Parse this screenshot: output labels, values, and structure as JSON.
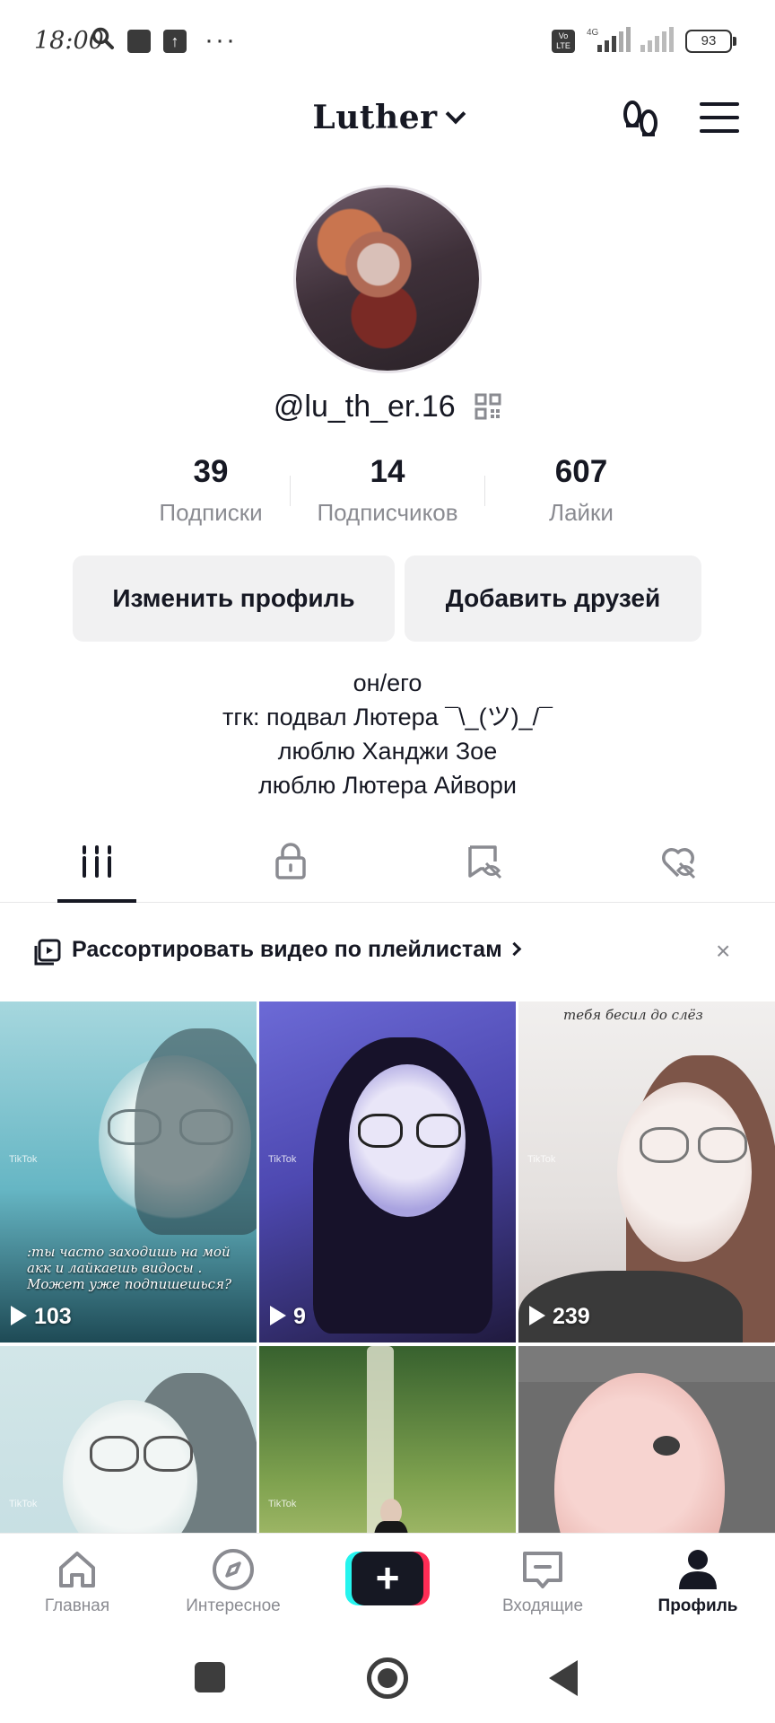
{
  "status_bar": {
    "time": "18:00",
    "volte": "Vo LTE",
    "network": "4G",
    "battery": "93"
  },
  "header": {
    "title": "Luther",
    "steps_icon": "footprints-icon",
    "menu_icon": "hamburger-menu-icon"
  },
  "profile": {
    "handle": "@lu_th_er.16",
    "stats": [
      {
        "value": "39",
        "label": "Подписки"
      },
      {
        "value": "14",
        "label": "Подписчиков"
      },
      {
        "value": "607",
        "label": "Лайки"
      }
    ],
    "edit_button": "Изменить профиль",
    "add_friends_button": "Добавить друзей",
    "bio": [
      "он/его",
      "тгк: подвал Лютера ¯\\_(ツ)_/¯",
      "люблю Ханджи Зое",
      "люблю Лютера Айвори"
    ]
  },
  "tabs": {
    "items": [
      "videos-grid-icon",
      "lock-icon",
      "hidden-reposts-icon",
      "hidden-likes-icon"
    ],
    "active": 0
  },
  "playlist_banner": {
    "text": "Рассортировать видео по плейлистам",
    "close": "×"
  },
  "videos": [
    {
      "views": "103",
      "caption": ":ты часто заходишь на мой акк и лайкаешь видосы . Может уже подпишешься?"
    },
    {
      "views": "9"
    },
    {
      "views": "239",
      "caption": "тебя бесил до слёз"
    },
    {},
    {},
    {}
  ],
  "watermark": "TikTok",
  "bottom_nav": [
    {
      "label": "Главная",
      "icon": "home-icon"
    },
    {
      "label": "Интересное",
      "icon": "compass-icon"
    },
    {
      "label": "+",
      "icon": "plus-icon"
    },
    {
      "label": "Входящие",
      "icon": "inbox-icon"
    },
    {
      "label": "Профиль",
      "icon": "profile-icon"
    }
  ],
  "colors": {
    "accent_cyan": "#25f4ee",
    "accent_red": "#fe2c55",
    "text_primary": "#161823",
    "text_secondary": "#8a8b91",
    "button_bg": "#f1f1f2"
  }
}
